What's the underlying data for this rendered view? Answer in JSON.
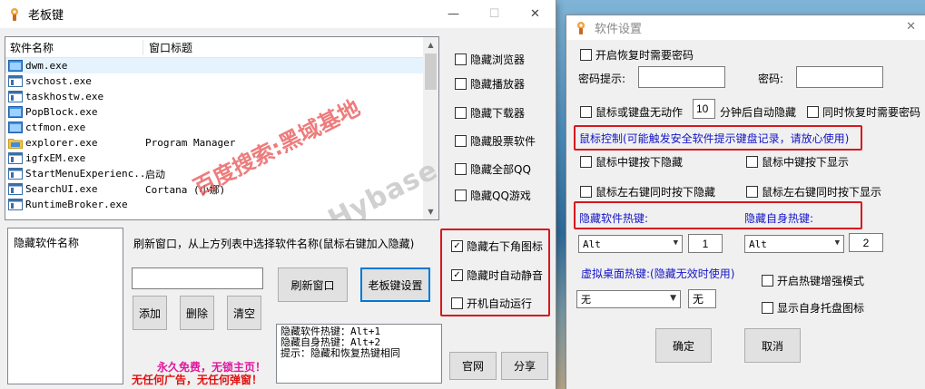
{
  "main": {
    "title": "老板键",
    "controls": {
      "minimize": "—",
      "maximize": "☐",
      "close": "✕"
    },
    "process_list": {
      "headers": [
        "软件名称",
        "窗口标题"
      ],
      "rows": [
        {
          "name": "dwm.exe",
          "title": "",
          "icon": "blue-window-icon"
        },
        {
          "name": "svchost.exe",
          "title": "",
          "icon": "app-window-icon"
        },
        {
          "name": "taskhostw.exe",
          "title": "",
          "icon": "app-window-icon"
        },
        {
          "name": "PopBlock.exe",
          "title": "",
          "icon": "blue-window-icon"
        },
        {
          "name": "ctfmon.exe",
          "title": "",
          "icon": "blue-window-icon"
        },
        {
          "name": "explorer.exe",
          "title": "Program Manager",
          "icon": "folder-icon"
        },
        {
          "name": "igfxEM.exe",
          "title": "",
          "icon": "app-window-icon"
        },
        {
          "name": "StartMenuExperienc...",
          "title": "启动",
          "icon": "app-window-icon"
        },
        {
          "name": "SearchUI.exe",
          "title": "Cortana (小娜)",
          "icon": "app-window-icon"
        },
        {
          "name": "RuntimeBroker.exe",
          "title": "",
          "icon": "app-window-icon"
        }
      ]
    },
    "hide_options": [
      "隐藏浏览器",
      "隐藏播放器",
      "隐藏下载器",
      "隐藏股票软件",
      "隐藏全部QQ",
      "隐藏QQ游戏"
    ],
    "hidden_list_header": "隐藏软件名称",
    "hint": "刷新窗口，从上方列表中选择软件名称(鼠标右键加入隐藏)",
    "input_value": "",
    "buttons": {
      "refresh": "刷新窗口",
      "settings": "老板键设置",
      "add": "添加",
      "delete": "删除",
      "clear": "清空",
      "website": "官网",
      "share": "分享"
    },
    "checks": [
      {
        "label": "隐藏右下角图标",
        "checked": true
      },
      {
        "label": "隐藏时自动静音",
        "checked": true
      },
      {
        "label": "开机自动运行",
        "checked": false
      }
    ],
    "info_lines": [
      "隐藏软件热键：Alt+1",
      "隐藏自身热键：Alt+2",
      "提示：隐藏和恢复热键相同"
    ],
    "promo_line1": "永久免费，无锁主页！",
    "promo_line2": "无任何广告，无任何弹窗！",
    "watermark1": "百度搜索:黑域基地",
    "watermark2": "Hybase.com"
  },
  "settings": {
    "title": "软件设置",
    "close": "✕",
    "require_password": "开启恢复时需要密码",
    "password_hint_label": "密码提示:",
    "password_label": "密码:",
    "password_hint_value": "",
    "password_value": "",
    "idle_before": "鼠标或键盘无动作",
    "idle_minutes": "10",
    "idle_after": "分钟后自动隐藏",
    "idle_require_password": "同时恢复时需要密码",
    "mouse_control_note": "鼠标控制(可能触发安全软件提示键盘记录，请放心使用)",
    "mouse_options": [
      "鼠标中键按下隐藏",
      "鼠标中键按下显示",
      "鼠标左右键同时按下隐藏",
      "鼠标左右键同时按下显示"
    ],
    "hotkey_soft_label": "隐藏软件热键:",
    "hotkey_self_label": "隐藏自身热键:",
    "hotkey_soft_mod": "Alt",
    "hotkey_soft_key": "1",
    "hotkey_self_mod": "Alt",
    "hotkey_self_key": "2",
    "virtual_desktop_label": "虚拟桌面热键:(隐藏无效时使用)",
    "virtual_mod": "无",
    "virtual_key": "无",
    "enhance_mode": "开启热键增强模式",
    "tray_icon": "显示自身托盘图标",
    "ok": "确定",
    "cancel": "取消"
  },
  "colors": {
    "accent_red": "#d9161d",
    "label_blue": "#1414c8",
    "promo_magenta": "#e0189c",
    "promo_red": "#e01010",
    "watermark": "#e85050"
  }
}
